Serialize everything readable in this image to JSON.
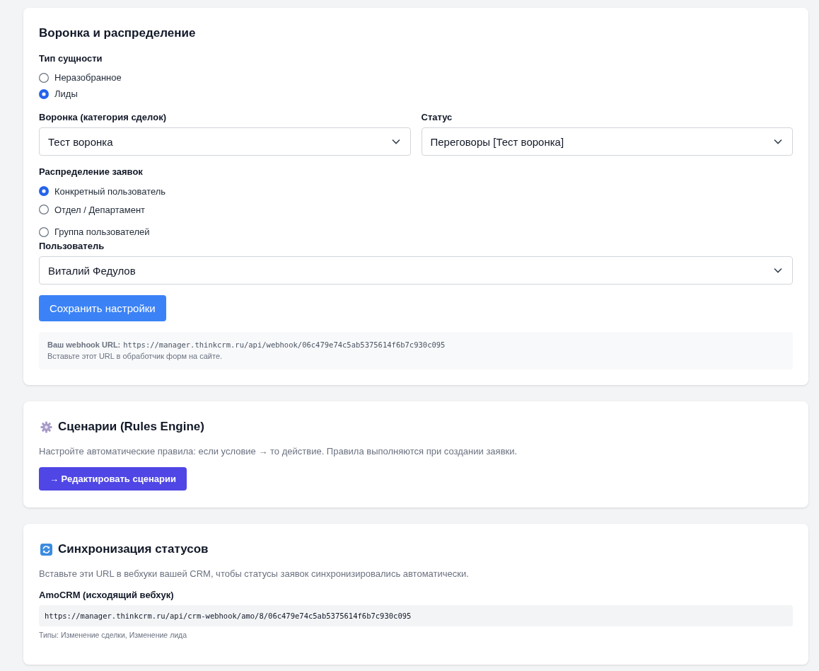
{
  "funnel_card": {
    "title": "Воронка и распределение",
    "entity_type": {
      "label": "Тип сущности",
      "options": [
        {
          "label": "Неразобранное",
          "selected": false
        },
        {
          "label": "Лиды",
          "selected": true
        }
      ]
    },
    "pipeline": {
      "label": "Воронка (категория сделок)",
      "value": "Тест воронка"
    },
    "status": {
      "label": "Статус",
      "value": "Переговоры [Тест воронка]"
    },
    "distribution": {
      "label": "Распределение заявок",
      "options": [
        {
          "label": "Конкретный пользователь",
          "selected": true
        },
        {
          "label": "Отдел / Департамент",
          "selected": false
        },
        {
          "label": "Группа пользователей",
          "selected": false
        }
      ]
    },
    "user": {
      "label": "Пользователь",
      "value": "Виталий Федулов"
    },
    "save_button": "Сохранить настройки",
    "webhook": {
      "label": "Ваш webhook URL:",
      "url": "https://manager.thinkcrm.ru/api/webhook/06c479e74c5ab5375614f6b7c930c095",
      "hint": "Вставьте этот URL в обработчик форм на сайте."
    }
  },
  "rules_card": {
    "title": "Сценарии (Rules Engine)",
    "description": "Настройте автоматические правила: если условие → то действие. Правила выполняются при создании заявки.",
    "button": "→ Редактировать сценарии"
  },
  "sync_card": {
    "title": "Синхронизация статусов",
    "description": "Вставьте эти URL в вебхуки вашей CRM, чтобы статусы заявок синхронизировались автоматически.",
    "integrations": [
      {
        "name": "AmoCRM (исходящий вебхук)",
        "url": "https://manager.thinkcrm.ru/api/crm-webhook/amo/8/06c479e74c5ab5375614f6b7c930c095",
        "types": "Типы: Изменение сделки, Изменение лида"
      }
    ]
  }
}
